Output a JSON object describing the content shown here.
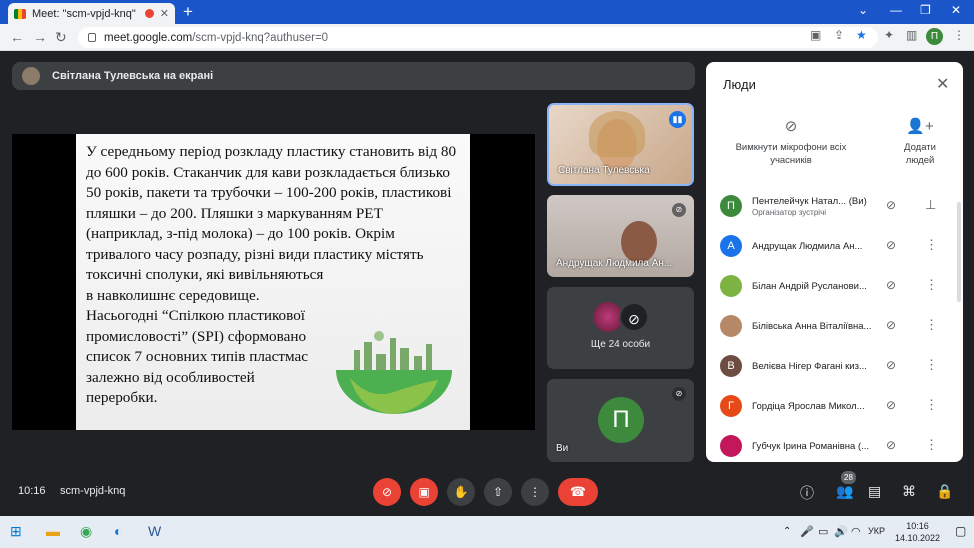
{
  "browser": {
    "tab_title": "Meet: \"scm-vpjd-knq\"",
    "tab_close": "✕",
    "new_tab": "+",
    "url_host": "meet.google.com",
    "url_path": "/scm-vpjd-knq?authuser=0",
    "profile_letter": "П"
  },
  "meet": {
    "presenter_banner": "Світлана Тулевська на екрані",
    "slide_text": "У середньому період розкладу пластику становить від 80 до 600 років. Стаканчик для кави розкладається близько 50 років, пакети та трубочки – 100-200 років, пластикові пляшки – до 200. Пляшки з маркуванням PET (наприклад, з-під молока) – до 100 років. Окрім тривалого часу розпаду, різні види пластику містять токсичні сполуки, які вивільняються\nв навколишнє середовище.\nНасьогодні “Спілкою пластикової\nпромисловості” (SPI) сформовано\nсписок 7 основних типів пластмас\nзалежно від особливостей\nпереробки.",
    "tiles": [
      {
        "name": "Світлана Тулевська"
      },
      {
        "name": "Андрущак Людмила Ан..."
      },
      {
        "name": "Ще 24 особи"
      },
      {
        "name": "Ви",
        "letter": "П"
      }
    ],
    "clock": "10:16",
    "meeting_code": "scm-vpjd-knq",
    "participant_count": "28"
  },
  "people": {
    "title": "Люди",
    "mute_all": "Вимкнути мікрофони всіх учасників",
    "add_people": "Додати людей",
    "rows": [
      {
        "letter": "П",
        "name": "Пентелейчук Натал...",
        "you": "(Ви)",
        "role": "Організатор зустрічі",
        "color": "#3d8a3d"
      },
      {
        "letter": "А",
        "name": "Андрущак Людмила Ан...",
        "color": "#1a73e8"
      },
      {
        "letter": "",
        "name": "Білан Андрій Русланови...",
        "color": "#7cb342"
      },
      {
        "letter": "",
        "name": "Білівська Анна Віталіївна...",
        "color": "#b58968"
      },
      {
        "letter": "В",
        "name": "Велієва Нігер Фагані киз...",
        "color": "#6d4c41"
      },
      {
        "letter": "Г",
        "name": "Гордіца Ярослав Микол...",
        "color": "#e64a19"
      },
      {
        "letter": "",
        "name": "Губчук Ірина Романівна (...",
        "color": "#c2185b"
      }
    ]
  },
  "taskbar": {
    "lang": "УКР",
    "time": "10:16",
    "date": "14.10.2022"
  }
}
